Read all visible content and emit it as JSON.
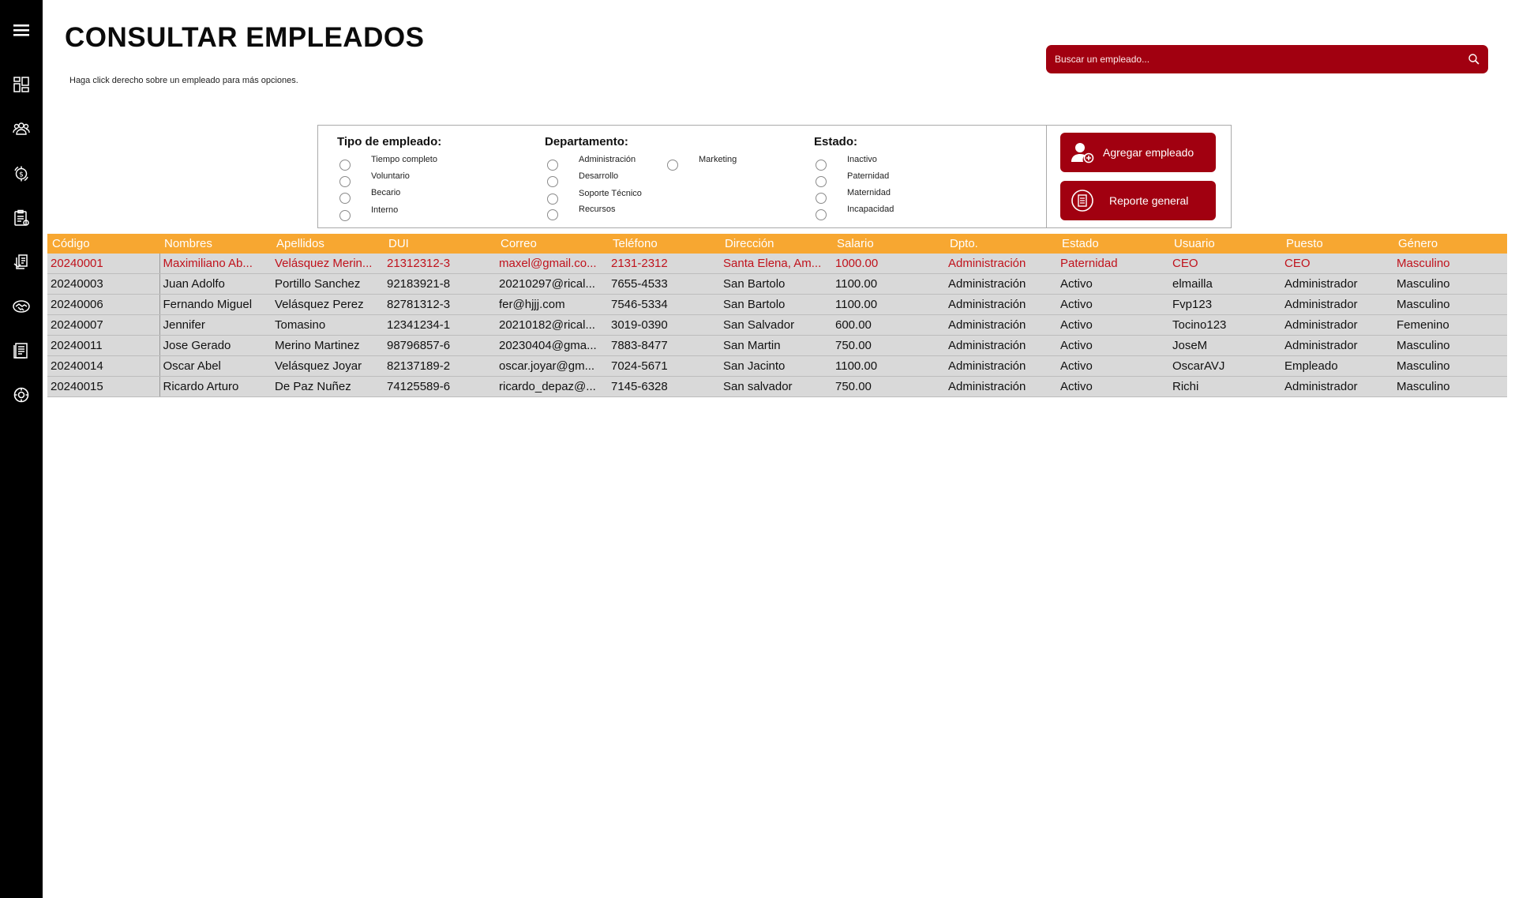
{
  "header": {
    "title": "CONSULTAR EMPLEADOS",
    "hint": "Haga click derecho sobre un empleado para más opciones."
  },
  "search": {
    "placeholder": "Buscar un empleado...",
    "value": ""
  },
  "sidebar": {
    "icons": [
      "menu-icon",
      "dashboard-icon",
      "employees-icon",
      "payroll-icon",
      "reports-icon",
      "documents-icon",
      "agreements-icon",
      "records-icon",
      "settings-icon"
    ]
  },
  "filters": {
    "tipo": {
      "title": "Tipo de empleado:",
      "options": [
        "Tiempo completo",
        "Voluntario",
        "Becario",
        "Interno"
      ]
    },
    "departamento": {
      "title": "Departamento:",
      "options": [
        "Administración",
        "Desarrollo",
        "Soporte Técnico",
        "Recursos",
        "Marketing"
      ]
    },
    "estado": {
      "title": "Estado:",
      "options": [
        "Inactivo",
        "Paternidad",
        "Maternidad",
        "Incapacidad"
      ]
    }
  },
  "actions": {
    "add_label": "Agregar empleado",
    "report_label": "Reporte general"
  },
  "table": {
    "columns": [
      "Código",
      "Nombres",
      "Apellidos",
      "DUI",
      "Correo",
      "Teléfono",
      "Dirección",
      "Salario",
      "Dpto.",
      "Estado",
      "Usuario",
      "Puesto",
      "Género"
    ],
    "rows": [
      [
        "20240001",
        "Maximiliano Ab...",
        "Velásquez Merin...",
        "21312312-3",
        "maxel@gmail.co...",
        "2131-2312",
        "Santa Elena, Am...",
        "1000.00",
        "Administración",
        "Paternidad",
        "CEO",
        "CEO",
        "Masculino"
      ],
      [
        "20240003",
        "Juan Adolfo",
        "Portillo Sanchez",
        "92183921-8",
        "20210297@rical...",
        "7655-4533",
        "San Bartolo",
        "1100.00",
        "Administración",
        "Activo",
        "elmailla",
        "Administrador",
        "Masculino"
      ],
      [
        "20240006",
        "Fernando Miguel",
        "Velásquez Perez",
        "82781312-3",
        "fer@hjjj.com",
        "7546-5334",
        "San Bartolo",
        "1100.00",
        "Administración",
        "Activo",
        "Fvp123",
        "Administrador",
        "Masculino"
      ],
      [
        "20240007",
        "Jennifer",
        "Tomasino",
        "12341234-1",
        "20210182@rical...",
        "3019-0390",
        "San Salvador",
        "600.00",
        "Administración",
        "Activo",
        "Tocino123",
        "Administrador",
        "Femenino"
      ],
      [
        "20240011",
        "Jose Gerado",
        "Merino Martinez",
        "98796857-6",
        "20230404@gma...",
        "7883-8477",
        "San Martin",
        "750.00",
        "Administración",
        "Activo",
        "JoseM",
        "Administrador",
        "Masculino"
      ],
      [
        "20240014",
        "Oscar Abel",
        "Velásquez Joyar",
        "82137189-2",
        "oscar.joyar@gm...",
        "7024-5671",
        "San Jacinto",
        "1100.00",
        "Administración",
        "Activo",
        "OscarAVJ",
        "Empleado",
        "Masculino"
      ],
      [
        "20240015",
        "Ricardo Arturo",
        "De Paz Nuñez",
        "74125589-6",
        "ricardo_depaz@...",
        "7145-6328",
        "San salvador",
        "750.00",
        "Administración",
        "Activo",
        "Richi",
        "Administrador",
        "Masculino"
      ]
    ],
    "selected_row": 0
  },
  "colors": {
    "sidebar": "#000000",
    "accent_red": "#a10010",
    "header_orange": "#f7a731",
    "row_gray": "#d9d9d9",
    "selected_text": "#c0121c"
  }
}
